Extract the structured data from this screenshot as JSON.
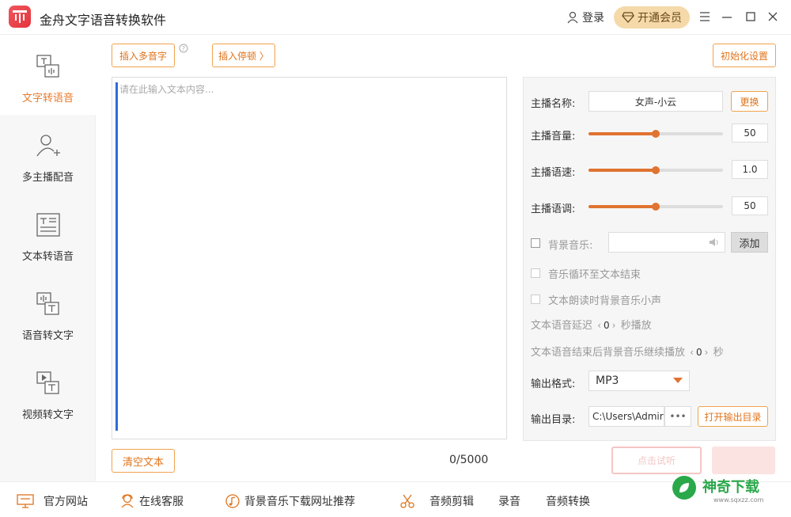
{
  "app": {
    "title": "金舟文字语音转换软件"
  },
  "header": {
    "login_label": "登录",
    "vip_label": "开通会员"
  },
  "sidebar": {
    "items": [
      {
        "label": "文字转语音",
        "icon": "text-to-speech-icon",
        "active": true
      },
      {
        "label": "多主播配音",
        "icon": "add-user-icon",
        "active": false
      },
      {
        "label": "文本转语音",
        "icon": "document-icon",
        "active": false
      },
      {
        "label": "语音转文字",
        "icon": "speech-to-text-icon",
        "active": false
      },
      {
        "label": "视频转文字",
        "icon": "video-to-text-icon",
        "active": false
      }
    ]
  },
  "toolbar": {
    "insert_polyphone": "插入多音字",
    "insert_pause": "插入停顿 〉",
    "reset_settings": "初始化设置"
  },
  "editor": {
    "placeholder": "请在此输入文本内容...",
    "clear_label": "清空文本",
    "char_count": "0/5000"
  },
  "panel": {
    "anchor_name_label": "主播名称:",
    "anchor_name_value": "女声-小云",
    "change_label": "更换",
    "volume_label": "主播音量:",
    "volume_value": "50",
    "volume_fraction": 0.5,
    "speed_label": "主播语速:",
    "speed_value": "1.0",
    "speed_fraction": 0.5,
    "pitch_label": "主播语调:",
    "pitch_value": "50",
    "pitch_fraction": 0.5,
    "bgm_label": "背景音乐:",
    "bgm_add_label": "添加",
    "loop_label": "音乐循环至文本结束",
    "duck_label": "文本朗读时背景音乐小声",
    "delay_prefix": "文本语音延迟",
    "delay_value": "0",
    "delay_suffix": "秒播放",
    "continue_prefix": "文本语音结束后背景音乐继续播放",
    "continue_value": "0",
    "continue_suffix": "秒",
    "format_label": "输出格式:",
    "format_value": "MP3",
    "dir_label": "输出目录:",
    "dir_value": "C:\\Users\\Admir",
    "dir_more": "•••",
    "open_dir_label": "打开输出目录"
  },
  "actions": {
    "preview_label": "点击试听"
  },
  "bottom": {
    "links": [
      {
        "label": "官方网站",
        "icon": "monitor-icon"
      },
      {
        "label": "在线客服",
        "icon": "service-icon"
      },
      {
        "label": "背景音乐下载网址推荐",
        "icon": "music-icon"
      },
      {
        "label": "音频剪辑",
        "icon": "scissors-icon"
      },
      {
        "label": "录音",
        "icon": ""
      },
      {
        "label": "音频转换",
        "icon": ""
      }
    ],
    "watermark_main": "神奇下载",
    "watermark_sub": "www.sqxzz.com"
  },
  "colors": {
    "accent": "#e07330",
    "vip_bg": "#f5d9a8",
    "logo": "#e3343d"
  }
}
